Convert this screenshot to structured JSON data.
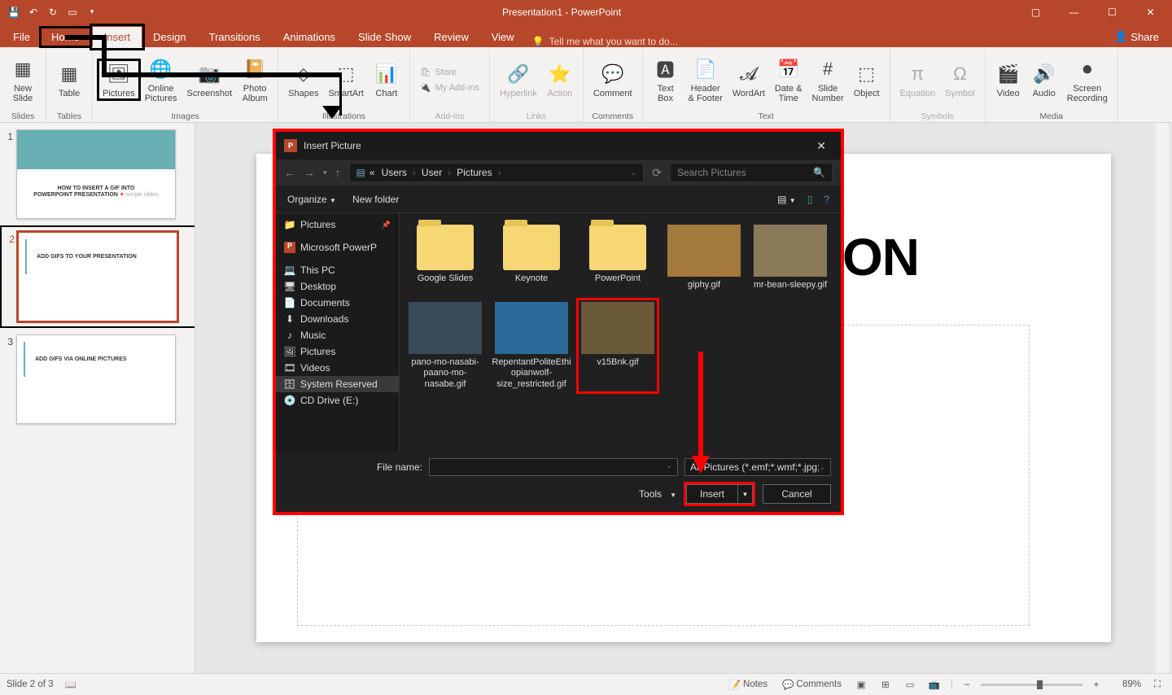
{
  "title": "Presentation1 - PowerPoint",
  "file_tab": "File",
  "tabs": [
    "Home",
    "Insert",
    "Design",
    "Transitions",
    "Animations",
    "Slide Show",
    "Review",
    "View"
  ],
  "active_tab_index": 1,
  "tellme": "Tell me what you want to do...",
  "share": "Share",
  "ribbon": {
    "groups": {
      "slides": {
        "label": "Slides",
        "new_slide": "New\nSlide"
      },
      "tables": {
        "label": "Tables",
        "table": "Table"
      },
      "images": {
        "label": "Images",
        "pictures": "Pictures",
        "online_pictures": "Online\nPictures",
        "screenshot": "Screenshot",
        "photo_album": "Photo\nAlbum"
      },
      "illustrations": {
        "label": "Illustrations",
        "shapes": "Shapes",
        "smartart": "SmartArt",
        "chart": "Chart"
      },
      "addins": {
        "label": "Add-ins",
        "store": "Store",
        "my_addins": "My Add-ins"
      },
      "links": {
        "label": "Links",
        "hyperlink": "Hyperlink",
        "action": "Action"
      },
      "comments": {
        "label": "Comments",
        "comment": "Comment"
      },
      "text": {
        "label": "Text",
        "textbox": "Text\nBox",
        "headerfooter": "Header\n& Footer",
        "wordart": "WordArt",
        "datetime": "Date &\nTime",
        "slidenum": "Slide\nNumber",
        "object": "Object"
      },
      "symbols": {
        "label": "Symbols",
        "equation": "Equation",
        "symbol": "Symbol"
      },
      "media": {
        "label": "Media",
        "video": "Video",
        "audio": "Audio",
        "screen": "Screen\nRecording"
      }
    }
  },
  "thumbnails": [
    {
      "num": "1",
      "content": [
        "HOW TO INSERT A GIF INTO",
        "POWERPOINT PRESENTATION"
      ],
      "brand": "simple slides"
    },
    {
      "num": "2",
      "content": [
        "ADD GIFS TO YOUR PRESENTATION"
      ]
    },
    {
      "num": "3",
      "content": [
        "ADD GIFS VIA  ONLINE PICTURES"
      ]
    }
  ],
  "slide_title_visible": "ON",
  "statusbar": {
    "slide_indicator": "Slide 2 of 3",
    "notes": "Notes",
    "comments": "Comments",
    "zoom_pct": "89%"
  },
  "dialog": {
    "title": "Insert Picture",
    "breadcrumb_prefix": "«",
    "breadcrumb": [
      "Users",
      "User",
      "Pictures"
    ],
    "search_placeholder": "Search Pictures",
    "organize": "Organize",
    "new_folder": "New folder",
    "tree": [
      {
        "icon": "📁",
        "label": "Pictures",
        "pin": true
      },
      {
        "icon": "P",
        "label": "Microsoft PowerP",
        "pp": true
      },
      {
        "icon": "💻",
        "label": "This PC",
        "pc": true
      },
      {
        "icon": "🖥",
        "label": "Desktop"
      },
      {
        "icon": "📄",
        "label": "Documents"
      },
      {
        "icon": "⬇",
        "label": "Downloads"
      },
      {
        "icon": "♪",
        "label": "Music"
      },
      {
        "icon": "🖼",
        "label": "Pictures"
      },
      {
        "icon": "🎞",
        "label": "Videos"
      },
      {
        "icon": "🗄",
        "label": "System Reserved",
        "sel": true
      },
      {
        "icon": "💿",
        "label": "CD Drive (E:)"
      }
    ],
    "files": [
      {
        "type": "folder",
        "name": "Google Slides"
      },
      {
        "type": "folder",
        "name": "Keynote"
      },
      {
        "type": "folder",
        "name": "PowerPoint"
      },
      {
        "type": "gif",
        "name": "giphy.gif",
        "bg": "#a47a3c"
      },
      {
        "type": "gif",
        "name": "mr-bean-sleepy.gif",
        "bg": "#8b7a5a"
      },
      {
        "type": "gif",
        "name": "pano-mo-nasabi-paano-mo-nasabe.gif",
        "bg": "#3a4a5a"
      },
      {
        "type": "gif",
        "name": "RepentantPoliteEthiopianwolf-size_restricted.gif",
        "bg": "#2a6b9a"
      },
      {
        "type": "gif",
        "name": "v15Bnk.gif",
        "bg": "#6a5a3a",
        "sel": true
      }
    ],
    "filename_label": "File name:",
    "filter": "All Pictures (*.emf;*.wmf;*.jpg;*",
    "tools": "Tools",
    "insert": "Insert",
    "cancel": "Cancel"
  }
}
